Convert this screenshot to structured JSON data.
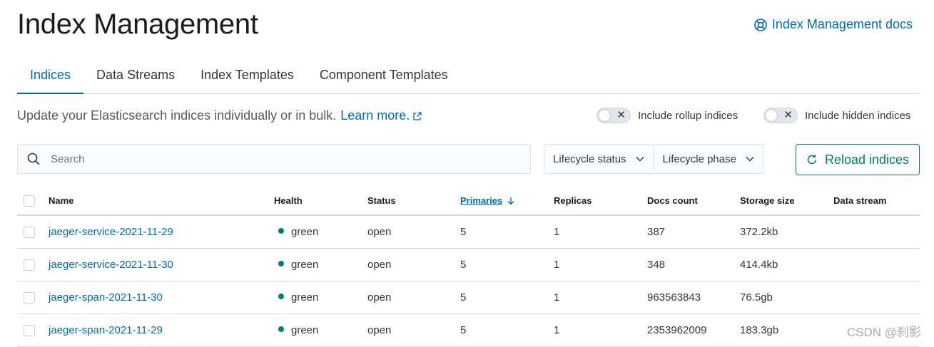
{
  "header": {
    "title": "Index Management",
    "docs_link": "Index Management docs"
  },
  "tabs": [
    {
      "label": "Indices",
      "active": true
    },
    {
      "label": "Data Streams",
      "active": false
    },
    {
      "label": "Index Templates",
      "active": false
    },
    {
      "label": "Component Templates",
      "active": false
    }
  ],
  "description": {
    "text": "Update your Elasticsearch indices individually or in bulk.",
    "learn_more": "Learn more."
  },
  "toggles": {
    "rollup": {
      "label": "Include rollup indices",
      "on": false
    },
    "hidden": {
      "label": "Include hidden indices",
      "on": false
    }
  },
  "search": {
    "placeholder": "Search"
  },
  "filters": {
    "lifecycle_status": "Lifecycle status",
    "lifecycle_phase": "Lifecycle phase"
  },
  "reload_button": "Reload indices",
  "table": {
    "columns": {
      "name": "Name",
      "health": "Health",
      "status": "Status",
      "primaries": "Primaries",
      "replicas": "Replicas",
      "docs_count": "Docs count",
      "storage_size": "Storage size",
      "data_stream": "Data stream"
    },
    "rows": [
      {
        "name": "jaeger-service-2021-11-29",
        "health": "green",
        "status": "open",
        "primaries": "5",
        "replicas": "1",
        "docs_count": "387",
        "storage_size": "372.2kb",
        "data_stream": ""
      },
      {
        "name": "jaeger-service-2021-11-30",
        "health": "green",
        "status": "open",
        "primaries": "5",
        "replicas": "1",
        "docs_count": "348",
        "storage_size": "414.4kb",
        "data_stream": ""
      },
      {
        "name": "jaeger-span-2021-11-30",
        "health": "green",
        "status": "open",
        "primaries": "5",
        "replicas": "1",
        "docs_count": "963563843",
        "storage_size": "76.5gb",
        "data_stream": ""
      },
      {
        "name": "jaeger-span-2021-11-29",
        "health": "green",
        "status": "open",
        "primaries": "5",
        "replicas": "1",
        "docs_count": "2353962009",
        "storage_size": "183.3gb",
        "data_stream": ""
      }
    ]
  },
  "colors": {
    "accent": "#006bb4",
    "success": "#017d73",
    "health_green": "#017d73"
  },
  "watermark": "CSDN @刹影"
}
